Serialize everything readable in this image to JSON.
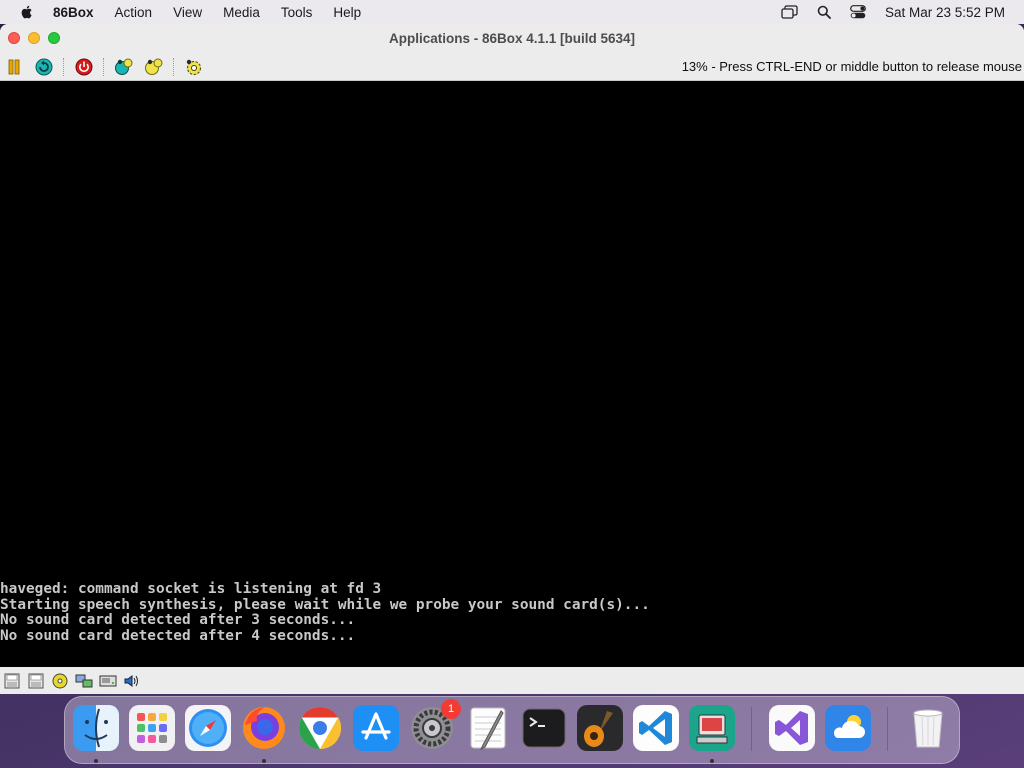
{
  "menubar": {
    "app_name": "86Box",
    "items": [
      "Action",
      "View",
      "Media",
      "Tools",
      "Help"
    ],
    "clock": "Sat Mar 23  5:52 PM",
    "status_icons": [
      "screen-mirroring-icon",
      "spotlight-search-icon",
      "control-center-icon"
    ]
  },
  "window": {
    "title": "Applications - 86Box 4.1.1 [build 5634]",
    "toolbar": {
      "buttons": [
        "pause-icon",
        "reset-icon",
        "power-icon",
        "ctrl-alt-del-icon",
        "ctrl-alt-esc-icon",
        "settings-icon"
      ],
      "status_message": "13% - Press CTRL-END or middle button to release mouse"
    },
    "console": {
      "lines": [
        "haveged: command socket is listening at fd 3",
        "Starting speech synthesis, please wait while we probe your sound card(s)...",
        "No sound card detected after 3 seconds...",
        "No sound card detected after 4 seconds..."
      ]
    },
    "statusbar": {
      "icons": [
        "floppy-1-icon",
        "floppy-2-icon",
        "cdrom-icon",
        "network-icon",
        "hard-disk-icon",
        "sound-icon"
      ]
    }
  },
  "dock": {
    "apps": [
      {
        "name": "Finder",
        "running": true
      },
      {
        "name": "Launchpad",
        "running": false
      },
      {
        "name": "Safari",
        "running": false
      },
      {
        "name": "Firefox",
        "running": true
      },
      {
        "name": "Chrome",
        "running": false
      },
      {
        "name": "App Store",
        "running": false
      },
      {
        "name": "System Settings",
        "running": false,
        "badge": "1"
      },
      {
        "name": "TextEdit",
        "running": false
      },
      {
        "name": "Terminal",
        "running": false
      },
      {
        "name": "GarageBand",
        "running": false
      },
      {
        "name": "Visual Studio Code",
        "running": false
      },
      {
        "name": "86Box",
        "running": true
      },
      {
        "name": "Visual Studio",
        "running": false
      },
      {
        "name": "Weather",
        "running": false
      },
      {
        "name": "Trash",
        "running": false
      }
    ]
  },
  "colors": {
    "close": "#fe5f57",
    "minimize": "#febc2e",
    "maximize": "#28c840",
    "console_text": "#c8c8c8",
    "screen_bg": "#000000"
  }
}
